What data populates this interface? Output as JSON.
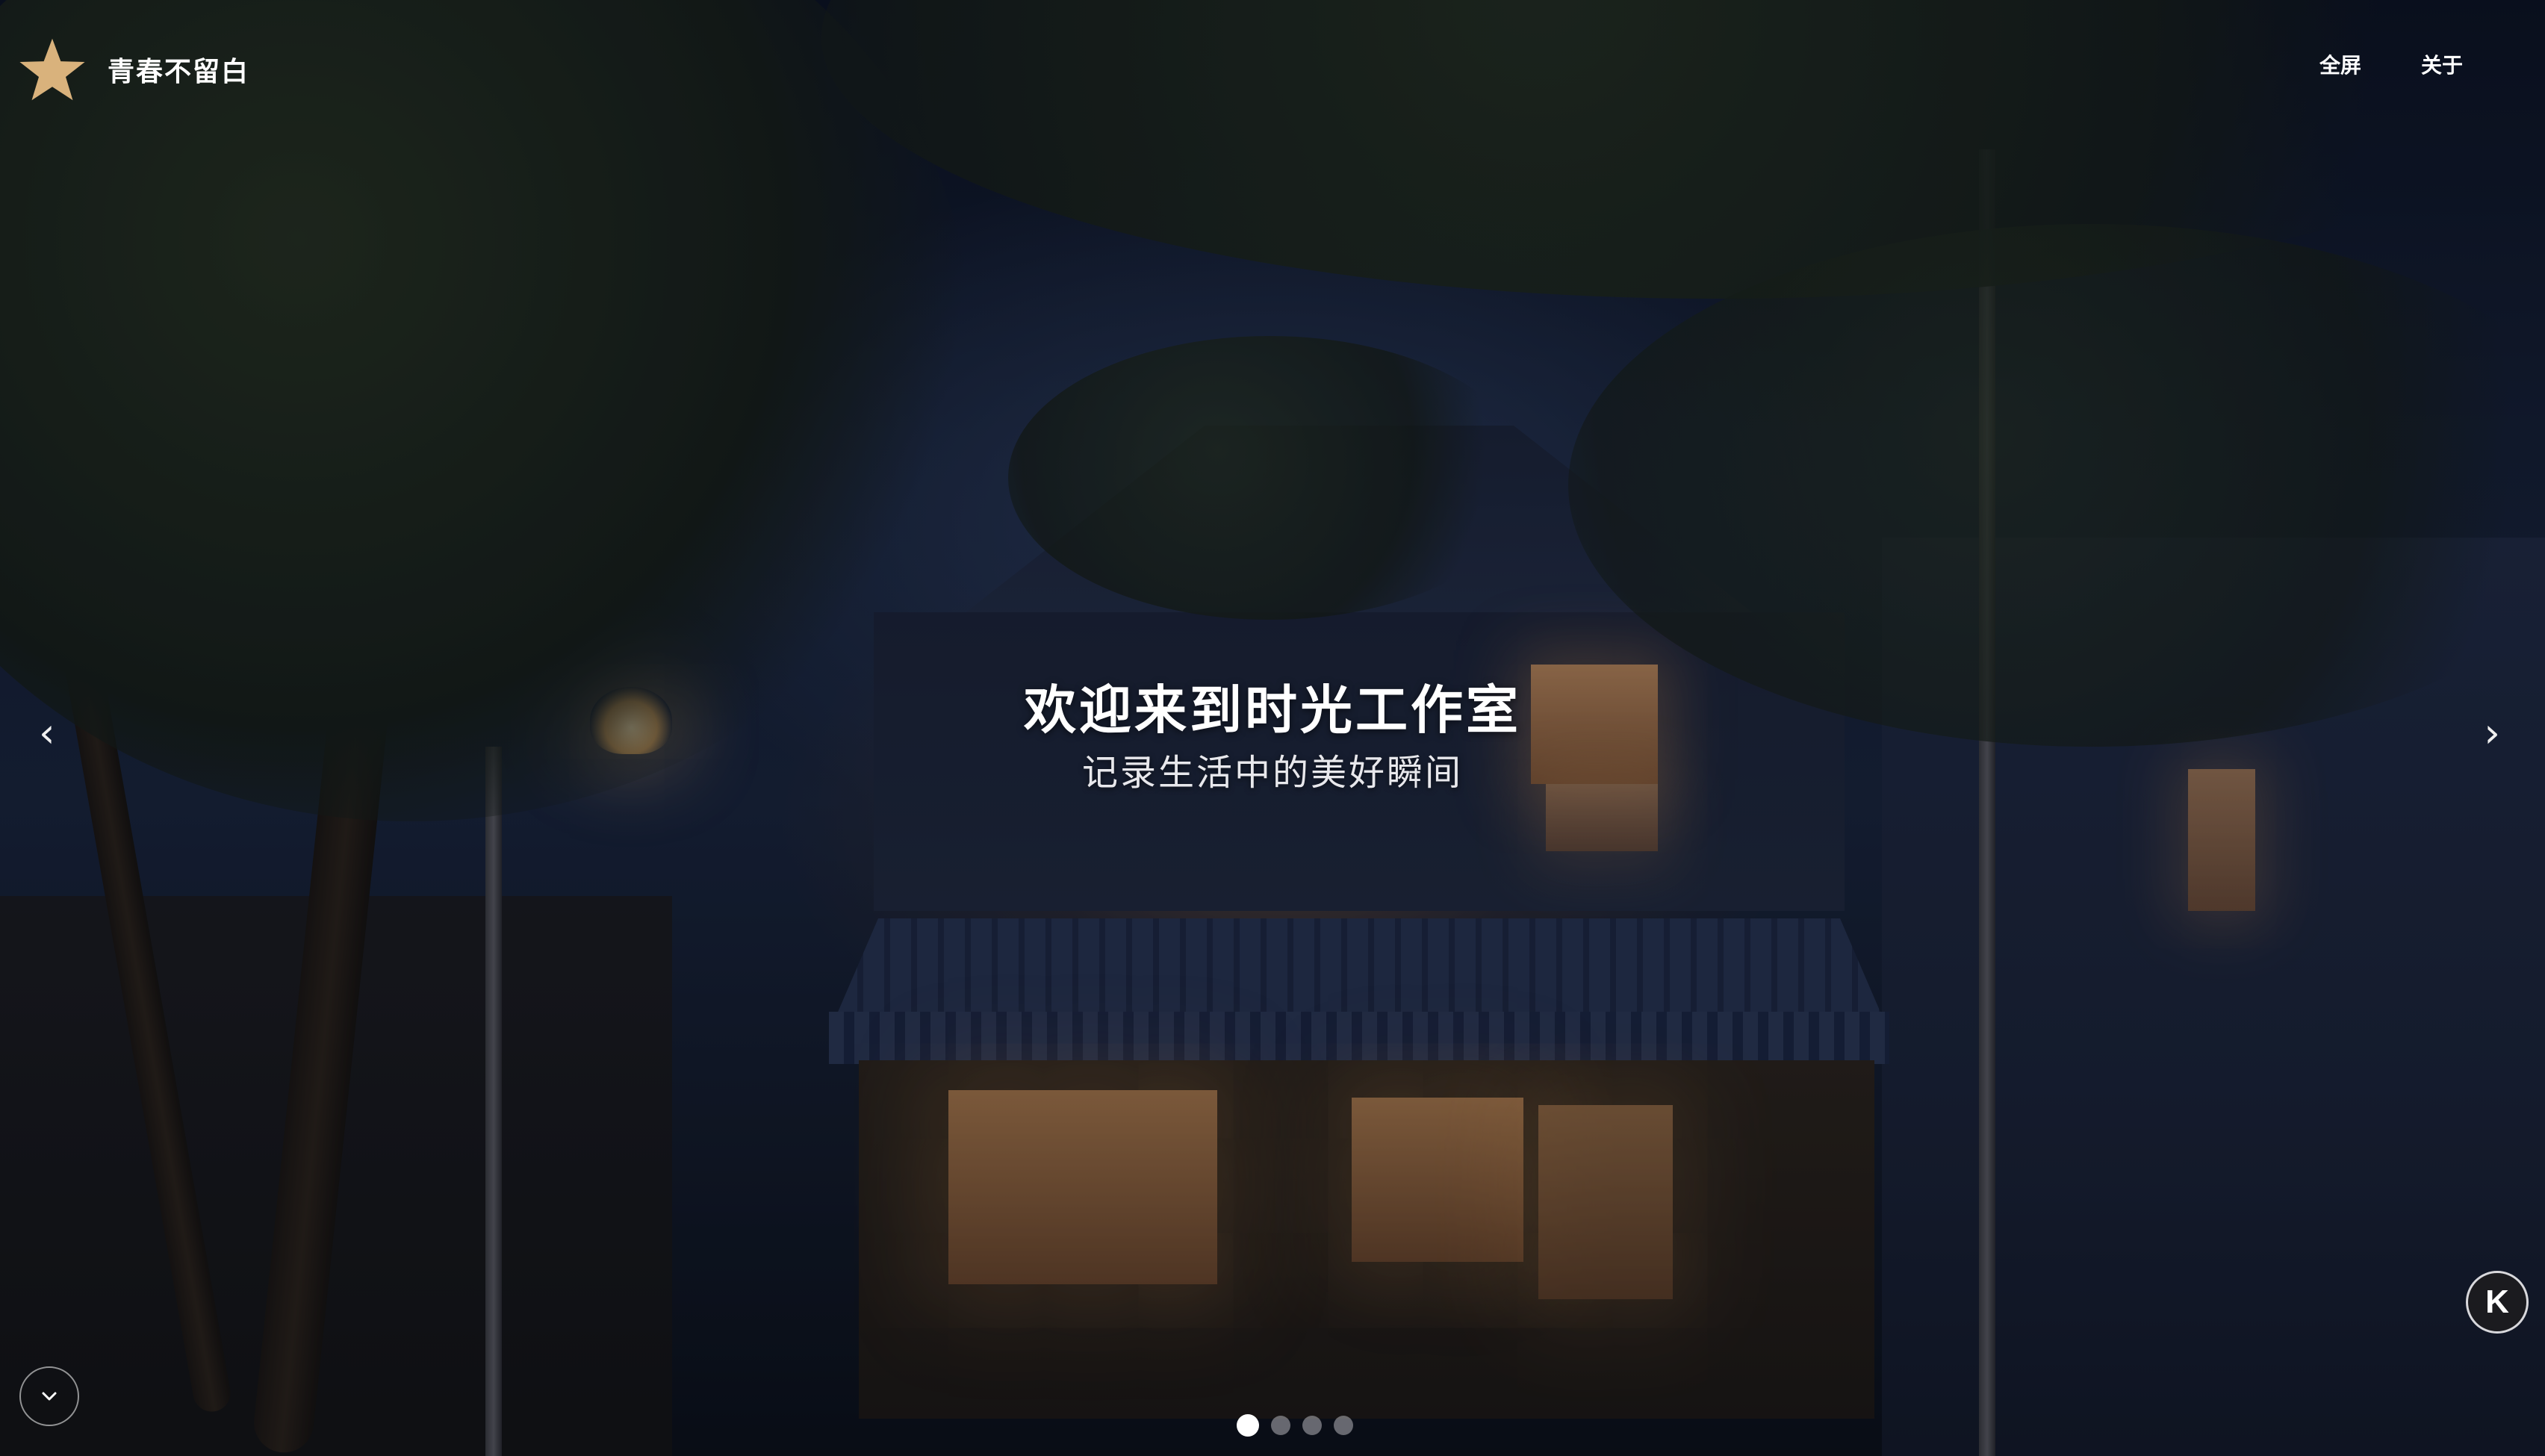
{
  "brand": {
    "name": "青春不留白",
    "logo_icon": "star-icon",
    "logo_color": "#d9b27c"
  },
  "nav": {
    "items": [
      {
        "label": "全屏"
      },
      {
        "label": "关于"
      }
    ]
  },
  "hero": {
    "title": "欢迎来到时光工作室",
    "subtitle": "记录生活中的美好瞬间",
    "prev_arrow": "‹",
    "next_arrow": "›",
    "slides_total": 4,
    "active_slide": 1
  },
  "controls": {
    "scroll_icon": "chevron-down-icon",
    "badge_letter": "K"
  }
}
